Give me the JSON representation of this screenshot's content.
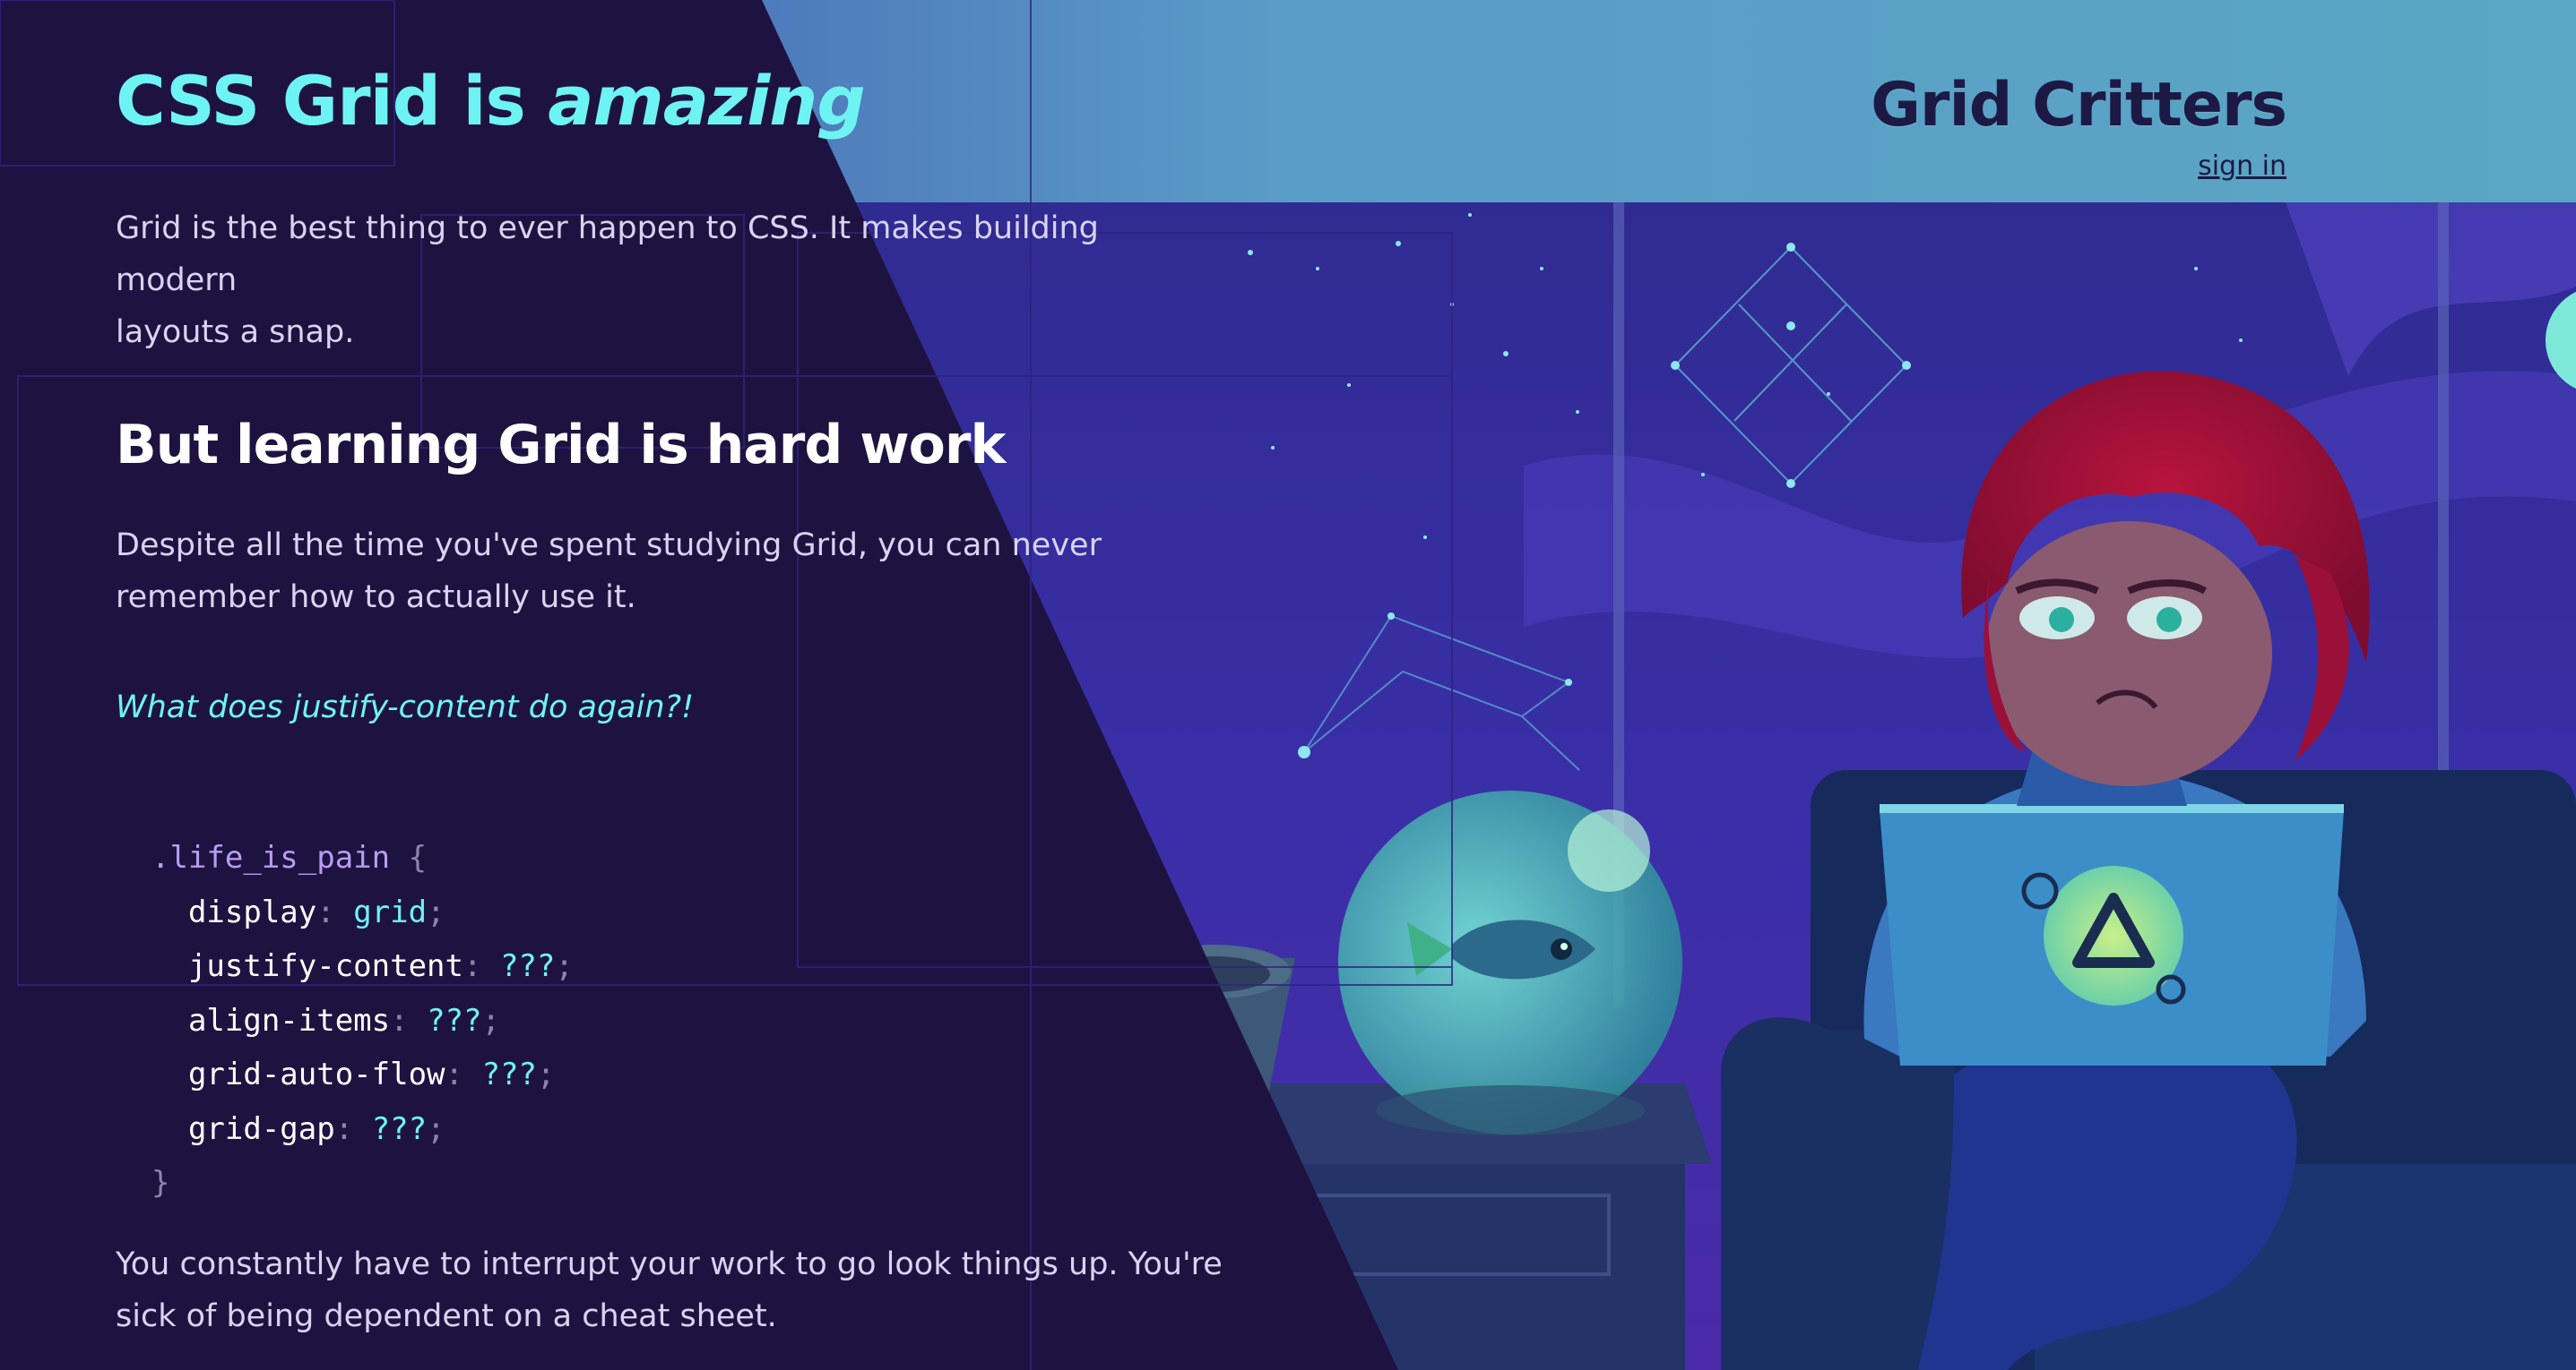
{
  "header": {
    "brand": "Grid Critters",
    "sign_in": "sign in"
  },
  "hero": {
    "title_prefix": "CSS Grid is ",
    "title_emphasis": "amazing",
    "intro_line1": "Grid is the best thing to ever happen to CSS. It makes building modern",
    "intro_line2": "layouts a snap."
  },
  "section": {
    "heading": "But learning Grid is hard work",
    "para_line1": "Despite all the time you've spent studying Grid, you can never",
    "para_line2": "remember how to actually use it.",
    "question": "What does justify-content do again?!",
    "outro_line1": "You constantly have to interrupt your work to go look things up. You're",
    "outro_line2": "sick of being dependent on a cheat sheet."
  },
  "code": {
    "selector": ".life_is_pain",
    "open_brace": "{",
    "close_brace": "}",
    "declarations": [
      {
        "prop": "display",
        "value": "grid"
      },
      {
        "prop": "justify-content",
        "value": "???"
      },
      {
        "prop": "align-items",
        "value": "???"
      },
      {
        "prop": "grid-auto-flow",
        "value": "???"
      },
      {
        "prop": "grid-gap",
        "value": "???"
      }
    ]
  },
  "colors": {
    "page_bg": "#1e1340",
    "accent_cyan": "#6ef3f3",
    "header_band": "#5aa6c4",
    "brand_text": "#1c1a45",
    "selector_purple": "#b89cf2"
  }
}
